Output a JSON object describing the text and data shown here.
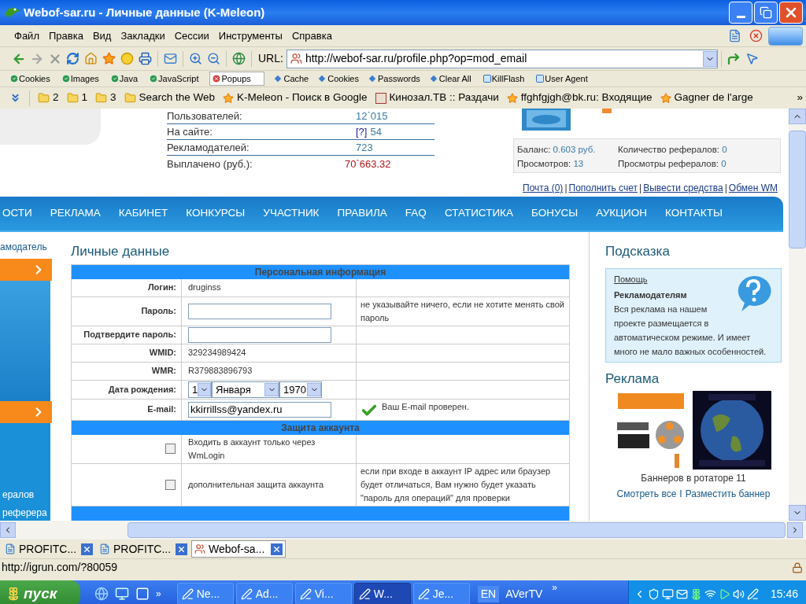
{
  "window": {
    "title": "Webof-sar.ru - Личные данные (K-Meleon)"
  },
  "menu": [
    {
      "label": "Файл"
    },
    {
      "label": "Правка"
    },
    {
      "label": "Вид"
    },
    {
      "label": "Закладки"
    },
    {
      "label": "Сессии"
    },
    {
      "label": "Инструменты"
    },
    {
      "label": "Справка"
    }
  ],
  "address": {
    "label": "URL:",
    "value": "http://webof-sar.ru/profile.php?op=mod_email"
  },
  "plugins": [
    {
      "label": "Cookies",
      "kind": "toggle",
      "on": true
    },
    {
      "label": "Images",
      "kind": "toggle",
      "on": true
    },
    {
      "label": "Java",
      "kind": "toggle",
      "on": true
    },
    {
      "label": "JavaScript",
      "kind": "toggle",
      "on": true
    },
    {
      "label": "Popups",
      "kind": "toggle",
      "on": false
    },
    {
      "label": "Cache",
      "kind": "action"
    },
    {
      "label": "Cookies",
      "kind": "action"
    },
    {
      "label": "Passwords",
      "kind": "action"
    },
    {
      "label": "Clear All",
      "kind": "action"
    },
    {
      "label": "KillFlash",
      "kind": "tool"
    },
    {
      "label": "User Agent",
      "kind": "tool"
    }
  ],
  "bookmarks": [
    {
      "label": "2",
      "kind": "folder"
    },
    {
      "label": "1",
      "kind": "folder"
    },
    {
      "label": "3",
      "kind": "folder"
    },
    {
      "label": "Search the Web",
      "kind": "folder"
    },
    {
      "label": "K-Meleon - Поиск в Google",
      "kind": "page"
    },
    {
      "label": "Кинозал.ТВ :: Раздачи",
      "kind": "site"
    },
    {
      "label": "ffghfgjgh@bk.ru: Входящие",
      "kind": "page"
    },
    {
      "label": "Gagner de l'arge",
      "kind": "page"
    }
  ],
  "bookmarks_more": "»",
  "stats": [
    {
      "label": "Пользователей:",
      "value": "12`015",
      "kind": "plain"
    },
    {
      "label": "На сайте:",
      "help": "[?]",
      "value": "54",
      "kind": "plain"
    },
    {
      "label": "Рекламодателей:",
      "value": "723",
      "kind": "plain"
    },
    {
      "label": "Выплачено (руб.):",
      "value": "70`663.32",
      "kind": "total"
    }
  ],
  "account": [
    {
      "label": "Баланс:",
      "value": "0.603 руб."
    },
    {
      "label": "Количество рефералов:",
      "value": "0"
    },
    {
      "label": "Просмотров:",
      "value": "13"
    },
    {
      "label": "Просмотры рефералов:",
      "value": "0"
    }
  ],
  "account_links": [
    "Почта (0)",
    "Пополнить счет",
    "Вывести средства",
    "Обмен WM"
  ],
  "link_separator": "|",
  "nav": [
    {
      "label": "ОСТИ"
    },
    {
      "label": "РЕКЛАМА"
    },
    {
      "label": "КАБИНЕТ"
    },
    {
      "label": "КОНКУРСЫ"
    },
    {
      "label": "УЧАСТНИК"
    },
    {
      "label": "ПРАВИЛА"
    },
    {
      "label": "FAQ"
    },
    {
      "label": "СТАТИСТИКА"
    },
    {
      "label": "БОНУСЫ"
    },
    {
      "label": "АУКЦИОН"
    },
    {
      "label": "КОНТАКТЫ"
    }
  ],
  "left_sidebar": {
    "top_text": "амодатель",
    "bottom_texts": [
      "ералов",
      "реферера"
    ]
  },
  "form": {
    "title": "Личные данные",
    "sections": [
      {
        "heading": "Персональная информация",
        "rows": [
          {
            "kind": "text",
            "label": "Логин:",
            "value": "druginss"
          },
          {
            "kind": "input",
            "label": "Пароль:",
            "note": "не указывайте ничего, если не хотите менять свой пароль"
          },
          {
            "kind": "input",
            "label": "Подтвердите пароль:"
          },
          {
            "kind": "text",
            "label": "WMID:",
            "value": "329234989424"
          },
          {
            "kind": "text",
            "label": "WMR:",
            "value": "R379883896793"
          },
          {
            "kind": "date",
            "label": "Дата рождения:",
            "day": "1",
            "month": "Января",
            "year": "1970"
          },
          {
            "kind": "input",
            "label": "E-mail:",
            "value": "kkirrillss@yandex.ru",
            "verified": true,
            "note": "Ваш E-mail проверен."
          }
        ]
      },
      {
        "heading": "Защита аккаунта",
        "rows": [
          {
            "kind": "checkbox",
            "checked": false,
            "value": "Входить в аккаунт только через WmLogin"
          },
          {
            "kind": "checkbox",
            "checked": false,
            "value": "дополнительная защита аккаунта",
            "note": "если при входе в аккаунт IP адрес или браузер будет отличаться, Вам нужно будет указать \"пароль для операций\" для проверки"
          }
        ]
      }
    ]
  },
  "hint": {
    "title": "Подсказка",
    "link": "Помощь",
    "heading": "Рекламодателям",
    "text": "Вся реклама на нашем проекте размещается в автоматическом режиме. И имеет много не мало важных особенностей."
  },
  "ads": {
    "title": "Реклама",
    "banners": [
      {
        "kind": "picture"
      },
      {
        "kind": "picture"
      }
    ],
    "caption": "Баннеров в ротаторе 11",
    "links": [
      "Смотреть все",
      "Разместить баннер"
    ],
    "separator": "I"
  },
  "tabs": [
    {
      "label": "PROFITC...",
      "selected": false
    },
    {
      "label": "PROFITC...",
      "selected": false
    },
    {
      "label": "Webof-sa...",
      "selected": true
    }
  ],
  "status_bar": {
    "text": "http://igrun.com/?80059"
  },
  "taskbar": {
    "start": "пуск",
    "more": "»",
    "tasks": [
      {
        "label": "Ne...",
        "selected": false
      },
      {
        "label": "Ad...",
        "selected": false
      },
      {
        "label": "Vi...",
        "selected": false
      },
      {
        "label": "W...",
        "selected": true
      },
      {
        "label": "Je...",
        "selected": false
      }
    ],
    "language": "EN",
    "toolbar_label": "AVerTV",
    "toolbar_more": "»",
    "time": "15:46"
  }
}
